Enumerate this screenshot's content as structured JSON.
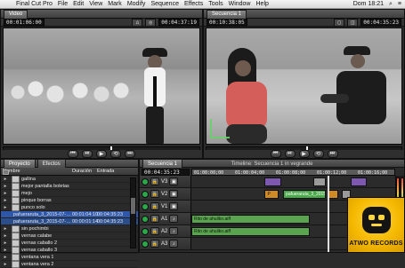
{
  "menubar": {
    "items": [
      "Final Cut Pro",
      "File",
      "Edit",
      "View",
      "Mark",
      "Modify",
      "Sequence",
      "Effects",
      "Tools",
      "Window",
      "Help"
    ],
    "right": {
      "time": "Dom 18:21"
    }
  },
  "viewer": {
    "tabs": [
      "Video"
    ],
    "timecode_left": "00:01:06:00",
    "timecode_right": "00:04:37:19"
  },
  "canvas": {
    "tabs": [
      "Secuencia 1"
    ],
    "timecode_left": "00:10:38:05",
    "timecode_right": "00:04:35:23"
  },
  "browser": {
    "tabs": [
      "Proyecto",
      "Efectos"
    ],
    "columns": [
      "Nombre",
      "Duración",
      "Entrada"
    ],
    "rows": [
      {
        "name": "gallina",
        "duration": "",
        "in": "",
        "type": "bin",
        "indent": 0,
        "selected": false
      },
      {
        "name": "mejor pantalla boletas",
        "duration": "",
        "in": "",
        "type": "bin",
        "indent": 0,
        "selected": false
      },
      {
        "name": "mejo",
        "duration": "",
        "in": "",
        "type": "bin",
        "indent": 0,
        "selected": false
      },
      {
        "name": "pinque borras",
        "duration": "",
        "in": "",
        "type": "bin",
        "indent": 0,
        "selected": false
      },
      {
        "name": "punco solo",
        "duration": "",
        "in": "",
        "type": "bin",
        "indent": 0,
        "selected": false
      },
      {
        "name": "pafueraruta_3_2015-07-18_0423_C0007",
        "duration": "00:01:04:10",
        "in": "00:04:35:23",
        "type": "clip",
        "indent": 1,
        "selected": true
      },
      {
        "name": "pafueraruta_3_2015-07-18_0425_C0008",
        "duration": "00:00:01:14",
        "in": "00:04:35:23",
        "type": "clip",
        "indent": 1,
        "selected": false,
        "selected2": true
      },
      {
        "name": "sin pochimbi",
        "duration": "",
        "in": "",
        "type": "bin",
        "indent": 0,
        "selected": false
      },
      {
        "name": "vernas calabe",
        "duration": "",
        "in": "",
        "type": "bin",
        "indent": 0,
        "selected": false
      },
      {
        "name": "vernas caballo 2",
        "duration": "",
        "in": "",
        "type": "bin",
        "indent": 0,
        "selected": false
      },
      {
        "name": "vernas caballo 3",
        "duration": "",
        "in": "",
        "type": "bin",
        "indent": 0,
        "selected": false
      },
      {
        "name": "ventana vera 1",
        "duration": "",
        "in": "",
        "type": "bin",
        "indent": 0,
        "selected": false
      },
      {
        "name": "ventana vera 2",
        "duration": "",
        "in": "",
        "type": "bin",
        "indent": 0,
        "selected": false
      }
    ]
  },
  "timeline": {
    "tabs": [
      "Secuencia 1"
    ],
    "title": "Timeline: Secuencia 1 in vegrande",
    "timecode": "00:04:35:23",
    "ruler_ticks": [
      "01:00:00;00",
      "01:00:04;00",
      "01:00:08;00",
      "01:00:12;00",
      "01:00:16;00"
    ],
    "tracks": [
      {
        "id": "V3",
        "label": "V3",
        "kind": "video",
        "clips": [
          {
            "label": "",
            "style": "video",
            "start": 0.36,
            "width": 0.08
          },
          {
            "label": "",
            "style": "gray",
            "start": 0.6,
            "width": 0.06
          },
          {
            "label": "",
            "style": "video",
            "start": 0.78,
            "width": 0.08
          }
        ]
      },
      {
        "id": "V2",
        "label": "V2",
        "kind": "video",
        "clips": [
          {
            "label": "P",
            "style": "orange",
            "start": 0.36,
            "width": 0.07
          },
          {
            "label": "pafueraruta_3_2015-07-18_0...",
            "style": "green",
            "start": 0.45,
            "width": 0.21
          },
          {
            "label": "",
            "style": "orange",
            "start": 0.67,
            "width": 0.05
          },
          {
            "label": "",
            "style": "gray",
            "start": 0.74,
            "width": 0.04
          }
        ]
      },
      {
        "id": "V1",
        "label": "V1",
        "kind": "video",
        "clips": []
      },
      {
        "id": "A1",
        "label": "A1",
        "kind": "audio",
        "clips": [
          {
            "label": "Rito de ahuilko.aiff",
            "style": "audio",
            "start": 0.0,
            "width": 0.58
          }
        ]
      },
      {
        "id": "A2",
        "label": "A2",
        "kind": "audio",
        "clips": [
          {
            "label": "Rito de ahuilko.aiff",
            "style": "audio",
            "start": 0.0,
            "width": 0.58
          }
        ]
      },
      {
        "id": "A3",
        "label": "A3",
        "kind": "audio",
        "clips": []
      }
    ]
  },
  "logo": {
    "text": "ATWO RECORDS"
  }
}
